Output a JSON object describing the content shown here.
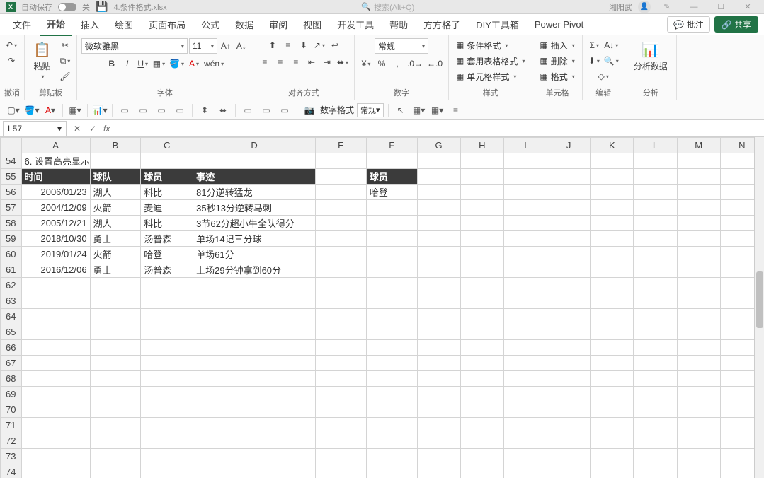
{
  "titlebar": {
    "autosave": "自动保存",
    "off": "关",
    "filename": "4.条件格式.xlsx",
    "search_placeholder": "搜索(Alt+Q)",
    "username": "湘阳武"
  },
  "menu": {
    "file": "文件",
    "tabs": [
      "开始",
      "插入",
      "绘图",
      "页面布局",
      "公式",
      "数据",
      "审阅",
      "视图",
      "开发工具",
      "帮助",
      "方方格子",
      "DIY工具箱",
      "Power Pivot"
    ],
    "comment": "批注",
    "share": "共享"
  },
  "ribbon": {
    "undo_label": "撤消",
    "clipboard_label": "剪贴板",
    "paste": "粘贴",
    "font_label": "字体",
    "font_name": "微软雅黑",
    "font_size": "11",
    "align_label": "对齐方式",
    "number_label": "数字",
    "number_format": "常规",
    "styles_label": "样式",
    "cond_format": "条件格式",
    "table_format": "套用表格格式",
    "cell_styles": "单元格样式",
    "cells_label": "单元格",
    "insert": "插入",
    "delete": "删除",
    "format": "格式",
    "editing_label": "编辑",
    "analysis_label": "分析",
    "analysis_data": "分析数据"
  },
  "quickbar": {
    "numfmt_label": "数字格式",
    "numfmt_value": "常规"
  },
  "formula": {
    "cellref": "L57"
  },
  "columns": [
    "A",
    "B",
    "C",
    "D",
    "E",
    "F",
    "G",
    "H",
    "I",
    "J",
    "K",
    "L",
    "M",
    "N"
  ],
  "rows_start": 54,
  "rows_end": 74,
  "data": {
    "title": "6. 设置高亮显示",
    "headers": [
      "时间",
      "球队",
      "球员",
      "事迹"
    ],
    "f_header": "球员",
    "f_value": "哈登",
    "records": [
      {
        "date": "2006/01/23",
        "team": "湖人",
        "player": "科比",
        "deed": "81分逆转猛龙"
      },
      {
        "date": "2004/12/09",
        "team": "火箭",
        "player": "麦迪",
        "deed": "35秒13分逆转马刺"
      },
      {
        "date": "2005/12/21",
        "team": "湖人",
        "player": "科比",
        "deed": "3节62分超小牛全队得分"
      },
      {
        "date": "2018/10/30",
        "team": "勇士",
        "player": "汤普森",
        "deed": "单场14记三分球"
      },
      {
        "date": "2019/01/24",
        "team": "火箭",
        "player": "哈登",
        "deed": "单场61分"
      },
      {
        "date": "2016/12/06",
        "team": "勇士",
        "player": "汤普森",
        "deed": "上场29分钟拿到60分"
      }
    ]
  }
}
